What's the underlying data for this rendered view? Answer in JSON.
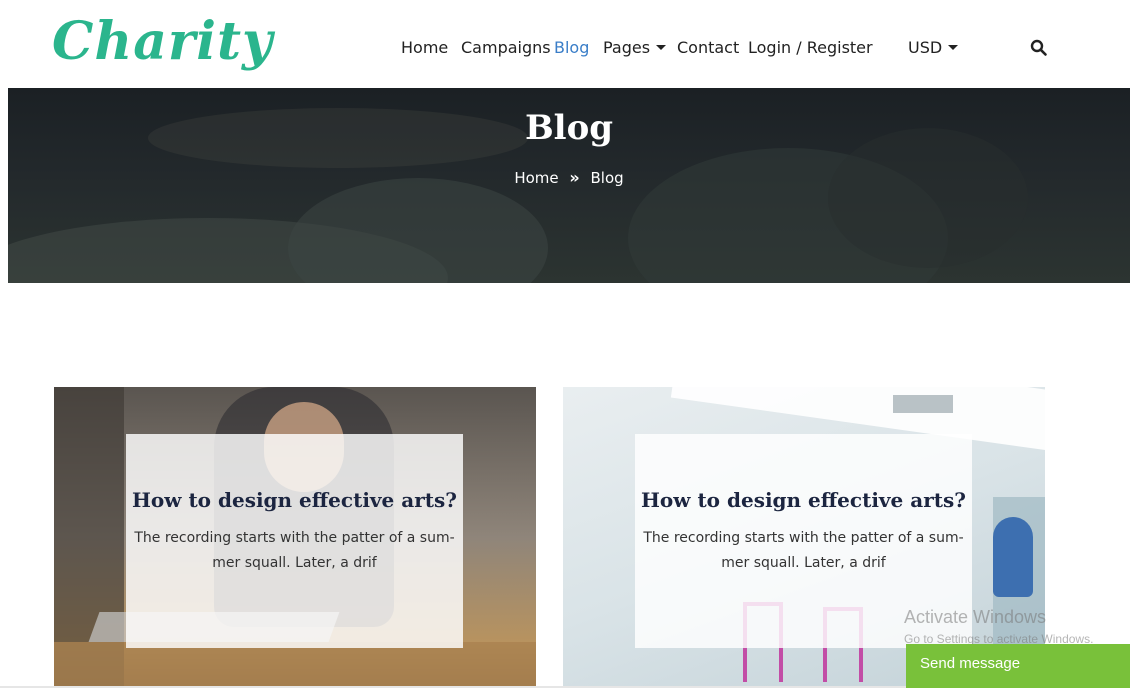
{
  "header": {
    "logo_text": "Charity",
    "nav": [
      {
        "label": "Home",
        "active": false,
        "dropdown": false
      },
      {
        "label": "Campaigns",
        "active": false,
        "dropdown": false
      },
      {
        "label": "Blog",
        "active": true,
        "dropdown": false
      },
      {
        "label": "Pages",
        "active": false,
        "dropdown": true
      },
      {
        "label": "Contact",
        "active": false,
        "dropdown": false
      },
      {
        "label": "Login / Register",
        "active": false,
        "dropdown": false
      }
    ],
    "currency": "USD",
    "search_icon": "search-icon"
  },
  "hero": {
    "title": "Blog",
    "breadcrumb": {
      "home": "Home",
      "separator": "»",
      "current": "Blog"
    }
  },
  "posts": [
    {
      "title": "How to design effective arts?",
      "excerpt": "The recording starts with the patter of a sum- mer squall. Later, a drif"
    },
    {
      "title": "How to design effective arts?",
      "excerpt": "The recording starts with the patter of a sum- mer squall. Later, a drif"
    }
  ],
  "watermark": {
    "title": "Activate Windows",
    "subtitle": "Go to Settings to activate Windows."
  },
  "chat": {
    "label": "Send message"
  },
  "colors": {
    "brand": "#2bb58d",
    "nav_active": "#3a7ec8",
    "send_button": "#79c13a",
    "title_dark": "#1c2540"
  }
}
